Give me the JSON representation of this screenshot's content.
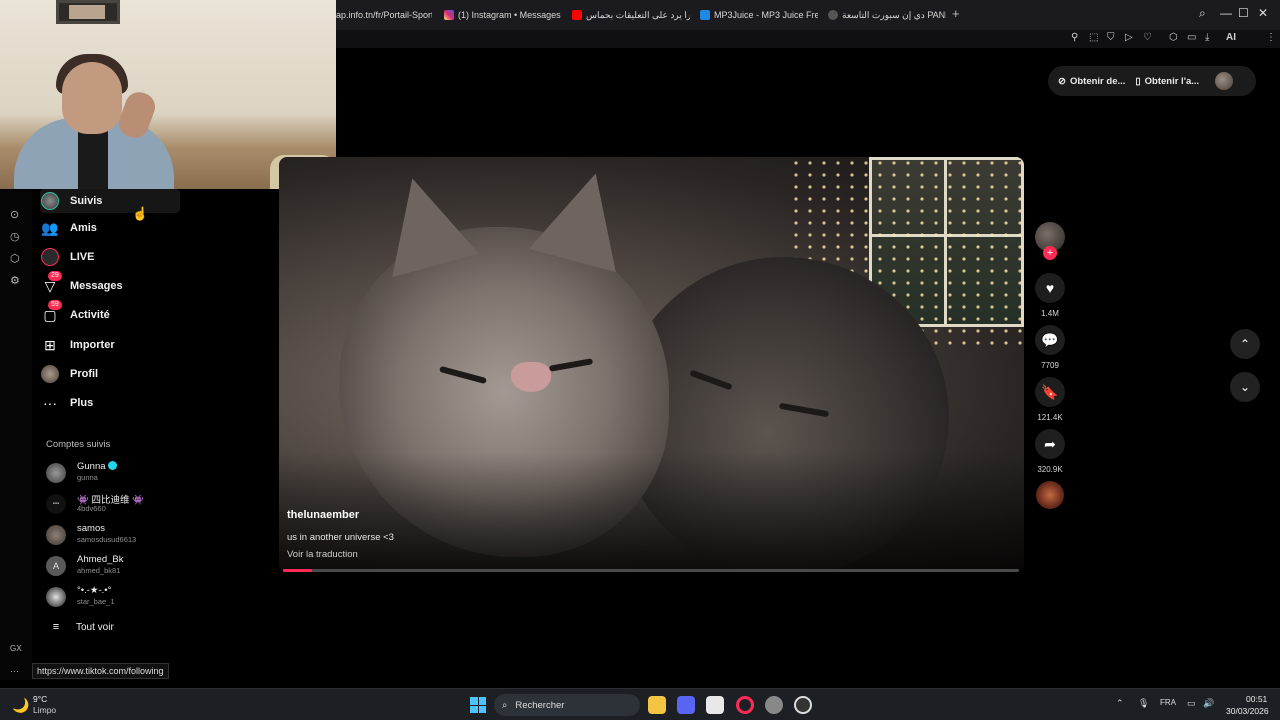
{
  "browser": {
    "tabs": [
      {
        "label": "ap.info.tn/fr/Portail-Sport",
        "color": "#ffffff"
      },
      {
        "label": "(1) Instagram • Messages",
        "color": "#d6249f"
      },
      {
        "label": "ساشارا يرد على التعليقات بحماس",
        "color": "#ff0000"
      },
      {
        "label": "MP3Juice - MP3 Juice Free",
        "color": "#1e88e5"
      },
      {
        "label": "دي إن سبورت التاسعة PANDA",
        "color": "#555555"
      }
    ],
    "new_tab": "+",
    "toolbar_ai": "AI"
  },
  "sidebar": {
    "nav": [
      {
        "label": "Suivis",
        "icon": "following-avatar-icon",
        "active": true
      },
      {
        "label": "Amis",
        "icon": "friends-icon"
      },
      {
        "label": "LIVE",
        "icon": "live-icon"
      },
      {
        "label": "Messages",
        "icon": "messages-icon",
        "badge": "29"
      },
      {
        "label": "Activité",
        "icon": "activity-icon",
        "badge": "59"
      },
      {
        "label": "Importer",
        "icon": "upload-icon"
      },
      {
        "label": "Profil",
        "icon": "profile-avatar-icon"
      },
      {
        "label": "Plus",
        "icon": "more-icon"
      }
    ],
    "followed_title": "Comptes suivis",
    "accounts": [
      {
        "name": "Gunna",
        "username": "gunna",
        "verified": true
      },
      {
        "name": "👾 四比迪维 👾",
        "username": "4bdv660"
      },
      {
        "name": "samos",
        "username": "samosdusud6613"
      },
      {
        "name": "Ahmed_Bk",
        "username": "ahmed_bk81",
        "initial": "A"
      },
      {
        "name": "°•.-★-.•°",
        "username": "star_bae_1"
      }
    ],
    "see_all": "Tout voir",
    "opera_gx": "GX",
    "opera_more": "···"
  },
  "top_buttons": {
    "btn1": "Obtenir de...",
    "btn2": "Obtenir l'a..."
  },
  "video": {
    "author": "thelunaember",
    "caption": "us in another universe <3",
    "translate": "Voir la traduction",
    "progress": 0.04
  },
  "actions": {
    "likes": "1.4M",
    "comments": "7709",
    "saves": "121.4K",
    "shares": "320.9K",
    "follow": "+"
  },
  "status_url": "https://www.tiktok.com/following",
  "taskbar": {
    "temp": "9°C",
    "condition": "Limpo",
    "search": "Rechercher",
    "lang": "FRA",
    "time": "00:51",
    "date": "30/03/2026"
  }
}
